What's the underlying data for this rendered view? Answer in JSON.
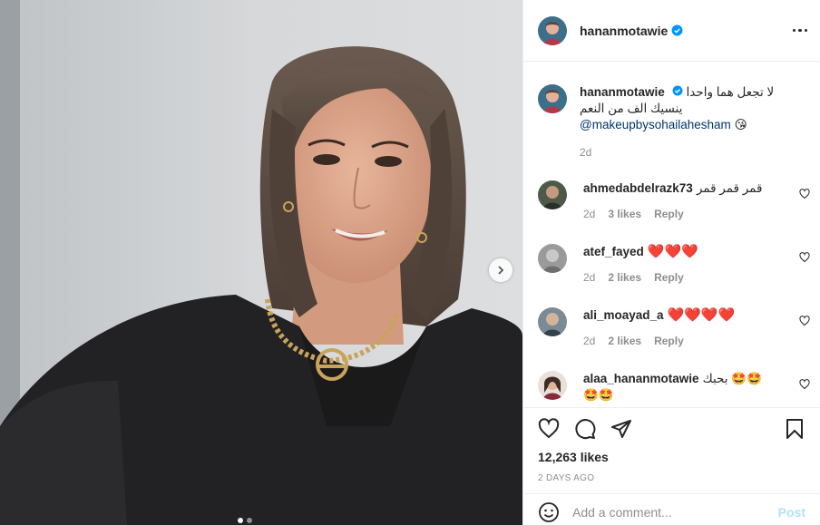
{
  "post": {
    "username": "hananmotawie",
    "verified_icon": "verified-badge-icon",
    "accent_color": "#0095f6"
  },
  "caption": {
    "username": "hananmotawie",
    "line1": "لا تجعل هما واحدا",
    "line2": "ينسيك الف من النعم",
    "mention": "@makeupbysohailahesham",
    "emoji": "😘",
    "time": "2d"
  },
  "comments": [
    {
      "user": "ahmedabdelrazk73",
      "text": "قمر قمر قمر",
      "time": "2d",
      "likes": "3 likes",
      "reply": "Reply"
    },
    {
      "user": "atef_fayed",
      "text": "❤️❤️❤️",
      "time": "2d",
      "likes": "2 likes",
      "reply": "Reply"
    },
    {
      "user": "ali_moayad_a",
      "text": "❤️❤️❤️❤️",
      "time": "2d",
      "likes": "2 likes",
      "reply": "Reply"
    },
    {
      "user": "alaa_hananmotawie",
      "text": "بحبك 🤩🤩",
      "text2": "🤩🤩"
    }
  ],
  "stats": {
    "likes": "12,263 likes",
    "date": "2 DAYS AGO"
  },
  "add_comment": {
    "placeholder": "Add a comment...",
    "post_label": "Post"
  }
}
